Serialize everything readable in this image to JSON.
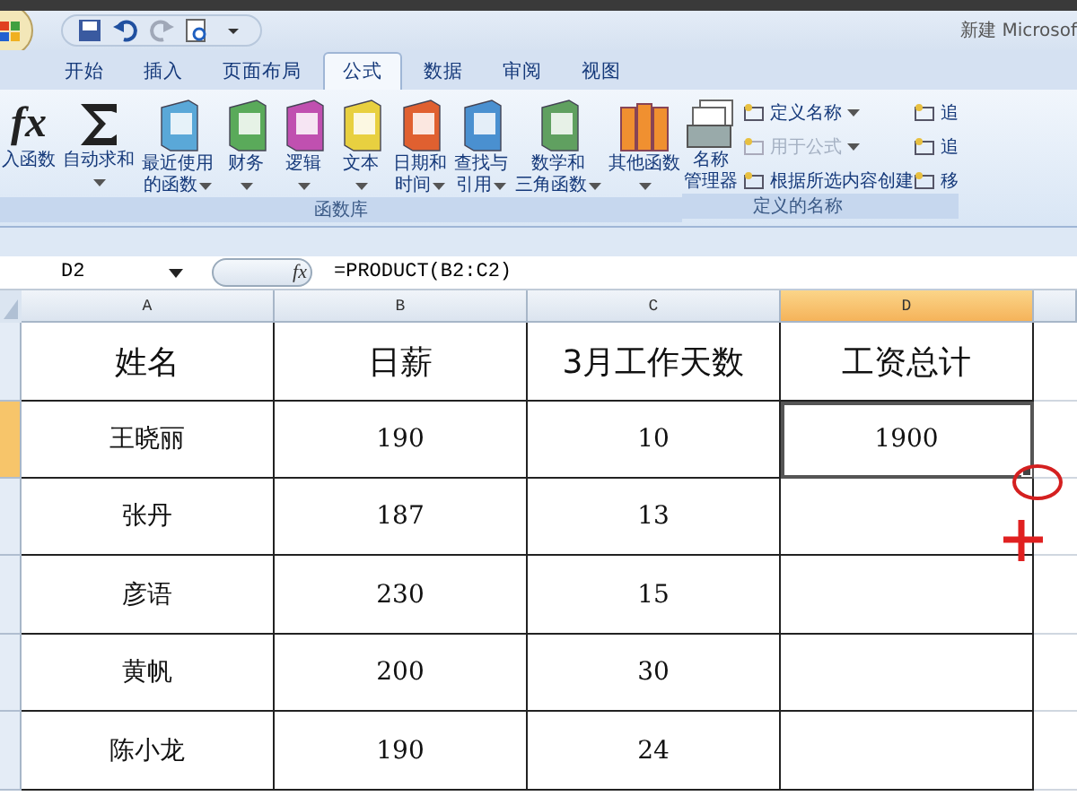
{
  "window": {
    "title": "新建 Microsof"
  },
  "tabs": [
    {
      "label": "开始",
      "selected": false
    },
    {
      "label": "插入",
      "selected": false
    },
    {
      "label": "页面布局",
      "selected": false
    },
    {
      "label": "公式",
      "selected": true
    },
    {
      "label": "数据",
      "selected": false
    },
    {
      "label": "审阅",
      "selected": false
    },
    {
      "label": "视图",
      "selected": false
    }
  ],
  "ribbon": {
    "groups": [
      {
        "label": "函数库",
        "buttons": [
          {
            "kind": "fx",
            "glyph": "fx",
            "lines": [
              "入函数"
            ],
            "menu": false
          },
          {
            "kind": "sigma",
            "lines": [
              "自动求和"
            ],
            "menu": true
          },
          {
            "kind": "book",
            "color": "#5aa8d8",
            "lines": [
              "最近使用",
              "的函数"
            ],
            "menu": true
          },
          {
            "kind": "book",
            "color": "#5aaa5a",
            "lines": [
              "财务"
            ],
            "menu": true
          },
          {
            "kind": "book",
            "color": "#c050b0",
            "lines": [
              "逻辑"
            ],
            "menu": true
          },
          {
            "kind": "book",
            "color": "#e8d040",
            "lines": [
              "文本"
            ],
            "menu": true
          },
          {
            "kind": "book",
            "color": "#e06030",
            "lines": [
              "日期和",
              "时间"
            ],
            "menu": true
          },
          {
            "kind": "book",
            "color": "#4a90d0",
            "lines": [
              "查找与",
              "引用"
            ],
            "menu": true
          },
          {
            "kind": "book",
            "color": "#60a060",
            "lines": [
              "数学和",
              "三角函数"
            ],
            "menu": true
          },
          {
            "kind": "books",
            "color": "#f09030",
            "lines": [
              "其他函数"
            ],
            "menu": true
          }
        ]
      },
      {
        "label": "定义的名称",
        "buttons": [
          {
            "kind": "cards",
            "lines": [
              "名称",
              "管理器"
            ],
            "menu": false
          }
        ],
        "small": [
          {
            "label": "定义名称",
            "menu": true,
            "disabled": false
          },
          {
            "label": "用于公式",
            "menu": true,
            "disabled": true
          },
          {
            "label": "根据所选内容创建",
            "menu": false,
            "disabled": false
          }
        ]
      },
      {
        "small": [
          {
            "label": "追",
            "menu": false,
            "disabled": false
          },
          {
            "label": "追",
            "menu": false,
            "disabled": false
          },
          {
            "label": "移",
            "menu": false,
            "disabled": false
          }
        ]
      }
    ]
  },
  "formula_bar": {
    "name_box": "D2",
    "fx": "fx",
    "formula": "=PRODUCT(B2:C2)"
  },
  "sheet": {
    "columns": [
      {
        "label": "A",
        "selected": false
      },
      {
        "label": "B",
        "selected": false
      },
      {
        "label": "C",
        "selected": false
      },
      {
        "label": "D",
        "selected": true
      }
    ],
    "rows": [
      {
        "selected": false,
        "cells": [
          "姓名",
          "日薪",
          "3月工作天数",
          "工资总计"
        ],
        "header": true
      },
      {
        "selected": true,
        "cells": [
          "王晓丽",
          "190",
          "10",
          "1900"
        ],
        "header": false
      },
      {
        "selected": false,
        "cells": [
          "张丹",
          "187",
          "13",
          ""
        ],
        "header": false
      },
      {
        "selected": false,
        "cells": [
          "彦语",
          "230",
          "15",
          ""
        ],
        "header": false
      },
      {
        "selected": false,
        "cells": [
          "黄帆",
          "200",
          "30",
          ""
        ],
        "header": false
      },
      {
        "selected": false,
        "cells": [
          "陈小龙",
          "190",
          "24",
          ""
        ],
        "header": false
      }
    ]
  }
}
